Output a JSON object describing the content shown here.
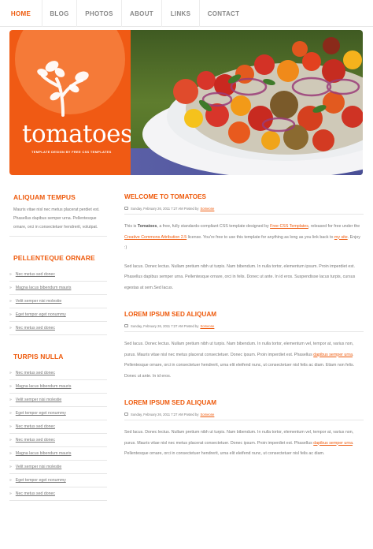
{
  "nav": {
    "items": [
      {
        "label": "HOME"
      },
      {
        "label": "BLOG"
      },
      {
        "label": "PHOTOS"
      },
      {
        "label": "ABOUT"
      },
      {
        "label": "LINKS"
      },
      {
        "label": "CONTACT"
      }
    ],
    "active_index": 0
  },
  "hero": {
    "title": "tomatoes",
    "subtitle": "TEMPLATE DESIGN BY FREE CSS TEMPLATES",
    "icon": "sprig-icon",
    "image": "tomato-salad-plate"
  },
  "sidebar": {
    "sections": [
      {
        "title": "ALIQUAM TEMPUS",
        "text": "Mauris vitae nisl nec metus placerat perdiet est. Phasellus dapibus semper urna. Pellentesque ornare, orci in consectetuer hendrerit, volutpat."
      },
      {
        "title": "PELLENTEQUE ORNARE",
        "links": [
          "Nec metus sed donec",
          "Magna lacus bibendum mauris",
          "Velit semper nisi molestie",
          "Eget tempor eget nonummy",
          "Nec metus sed donec"
        ]
      },
      {
        "title": "TURPIS NULLA",
        "links": [
          "Nec metus sed donec",
          "Magna lacus bibendum mauris",
          "Velit semper nisi molestie",
          "Eget tempor eget nonummy",
          "Nec metus sed donec",
          "Nec metus sed donec",
          "Magna lacus bibendum mauris",
          "Velit semper nisi molestie",
          "Eget tempor eget nonummy",
          "Nec metus sed donec"
        ]
      }
    ]
  },
  "posts": [
    {
      "title": "WELCOME TO TOMATOES",
      "date": "Sunday, February 26, 2011 7:27 AM Posted by",
      "author": "Someone",
      "p1": {
        "a": "This is ",
        "b": "Tomatoes",
        "c": ", a free, fully standards-compliant CSS template designed by ",
        "link1": "Free CSS Templates",
        "d": ", released for free under the ",
        "link2": "Creative Commons Attribution 2.5",
        "e": " license. You're free to use this template for anything as long as you link back to ",
        "link3": "my site",
        "f": ". Enjoy :)"
      },
      "p2": "Sed lacus. Donec lectus. Nullam pretium nibh ut turpis. Nam bibendum. In nulla tortor, elementum ipsum. Proin imperdiet est. Phasellus dapibus semper urna. Pellentesque ornare, orci in felis. Donec ut ante. In id eros. Suspendisse lacus turpis, cursus egestas at sem.Sed lacus."
    },
    {
      "title": "LOREM IPSUM SED ALIQUAM",
      "date": "Sunday, February 26, 2011 7:27 AM Posted by",
      "author": "Someone",
      "p1a": "Sed lacus. Donec lectus. Nullam pretium nibh ut turpis. Nam bibendum. In nulla tortor, elementum vel, tempor at, varius non, purus. Mauris vitae nisl nec metus placerat consectetuer. Donec ipsum. Proin imperdiet est. Phasellus ",
      "link": "dapibus semper urna",
      "p1b": ". Pellentesque ornare, orci in consectetuer hendrerit, urna elit eleifend nunc, ut consectetuer nisl felis ac diam. Etiam non felis. Donec ut ante. In id eros."
    },
    {
      "title": "LOREM IPSUM SED ALIQUAM",
      "date": "Sunday, February 26, 2011 7:27 AM Posted by",
      "author": "Someone",
      "p1a": "Sed lacus. Donec lectus. Nullam pretium nibh ut turpis. Nam bibendum. In nulla tortor, elementum vel, tempor at, varius non, purus. Mauris vitae nisl nec metus placerat consectetuer. Donec ipsum. Proin imperdiet est. Phasellus ",
      "link": "dapibus semper urna",
      "p1b": ". Pellentesque ornare, orci in consectetuer hendrerit, urna elit eleifend nunc, ut consectetuer nisl felis ac diam."
    }
  ],
  "colors": {
    "accent": "#ee5a0c",
    "hero_orange": "#f05a14",
    "text": "#777777",
    "divider": "#e6e6e6"
  }
}
